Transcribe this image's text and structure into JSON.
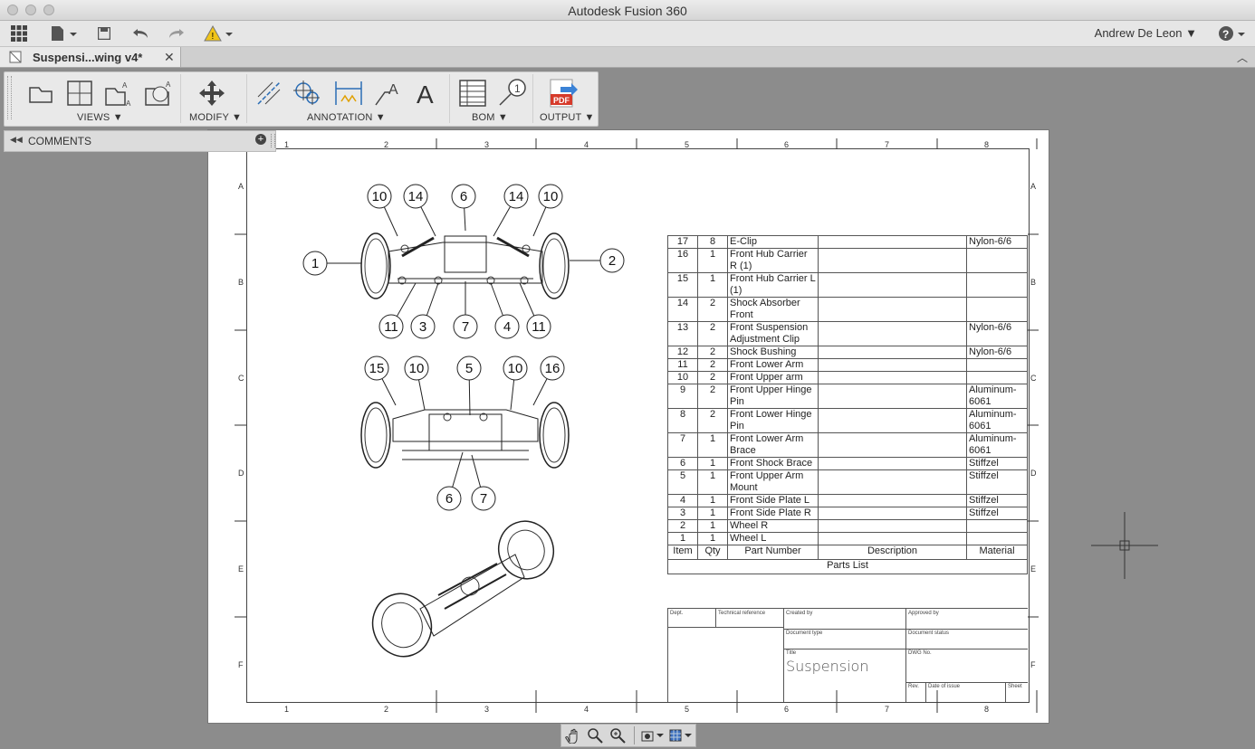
{
  "window": {
    "title": "Autodesk Fusion 360"
  },
  "toolbar": {
    "user": "Andrew De Leon"
  },
  "tab": {
    "label": "Suspensi...wing v4*"
  },
  "ribbon": {
    "groups": [
      "VIEWS",
      "MODIFY",
      "ANNOTATION",
      "BOM",
      "OUTPUT"
    ],
    "pdf_label": "PDF"
  },
  "comments": {
    "label": "COMMENTS"
  },
  "sheet": {
    "zones_x": [
      "1",
      "2",
      "3",
      "4",
      "5",
      "6",
      "7",
      "8"
    ],
    "zones_y": [
      "A",
      "B",
      "C",
      "D",
      "E",
      "F"
    ],
    "balloons_top": [
      "10",
      "14",
      "6",
      "14",
      "10",
      "1",
      "2",
      "11",
      "3",
      "7",
      "4",
      "11"
    ],
    "balloons_mid": [
      "15",
      "10",
      "5",
      "10",
      "16",
      "6",
      "7"
    ]
  },
  "parts_list": {
    "rows": [
      {
        "item": "17",
        "qty": "8",
        "part": "E-Clip",
        "desc": "",
        "mat": "Nylon-6/6"
      },
      {
        "item": "16",
        "qty": "1",
        "part": "Front Hub Carrier R (1)",
        "desc": "",
        "mat": ""
      },
      {
        "item": "15",
        "qty": "1",
        "part": "Front Hub Carrier L (1)",
        "desc": "",
        "mat": ""
      },
      {
        "item": "14",
        "qty": "2",
        "part": "Shock Absorber Front",
        "desc": "",
        "mat": ""
      },
      {
        "item": "13",
        "qty": "2",
        "part": "Front Suspension Adjustment Clip",
        "desc": "",
        "mat": "Nylon-6/6"
      },
      {
        "item": "12",
        "qty": "2",
        "part": "Shock Bushing",
        "desc": "",
        "mat": "Nylon-6/6"
      },
      {
        "item": "11",
        "qty": "2",
        "part": "Front Lower Arm",
        "desc": "",
        "mat": ""
      },
      {
        "item": "10",
        "qty": "2",
        "part": "Front Upper arm",
        "desc": "",
        "mat": ""
      },
      {
        "item": "9",
        "qty": "2",
        "part": "Front Upper Hinge Pin",
        "desc": "",
        "mat": "Aluminum-6061"
      },
      {
        "item": "8",
        "qty": "2",
        "part": "Front Lower Hinge Pin",
        "desc": "",
        "mat": "Aluminum-6061"
      },
      {
        "item": "7",
        "qty": "1",
        "part": "Front Lower Arm Brace",
        "desc": "",
        "mat": "Aluminum-6061"
      },
      {
        "item": "6",
        "qty": "1",
        "part": "Front Shock Brace",
        "desc": "",
        "mat": "Stiffzel"
      },
      {
        "item": "5",
        "qty": "1",
        "part": "Front Upper Arm Mount",
        "desc": "",
        "mat": "Stiffzel"
      },
      {
        "item": "4",
        "qty": "1",
        "part": "Front Side Plate L",
        "desc": "",
        "mat": "Stiffzel"
      },
      {
        "item": "3",
        "qty": "1",
        "part": "Front Side Plate R",
        "desc": "",
        "mat": "Stiffzel"
      },
      {
        "item": "2",
        "qty": "1",
        "part": "Wheel R",
        "desc": "",
        "mat": ""
      },
      {
        "item": "1",
        "qty": "1",
        "part": "Wheel L",
        "desc": "",
        "mat": ""
      }
    ],
    "headers": {
      "item": "Item",
      "qty": "Qty",
      "part": "Part Number",
      "desc": "Description",
      "mat": "Material"
    },
    "caption": "Parts List"
  },
  "title_block": {
    "dept": "Dept.",
    "tech_ref": "Technical reference",
    "created_by": "Created by",
    "approved_by": "Approved by",
    "doc_type": "Document type",
    "doc_status": "Document status",
    "title_label": "Title",
    "title": "Suspension",
    "dwg_no": "DWG No.",
    "rev": "Rev.",
    "date_of_issue": "Date of issue",
    "sheet": "Sheet"
  }
}
